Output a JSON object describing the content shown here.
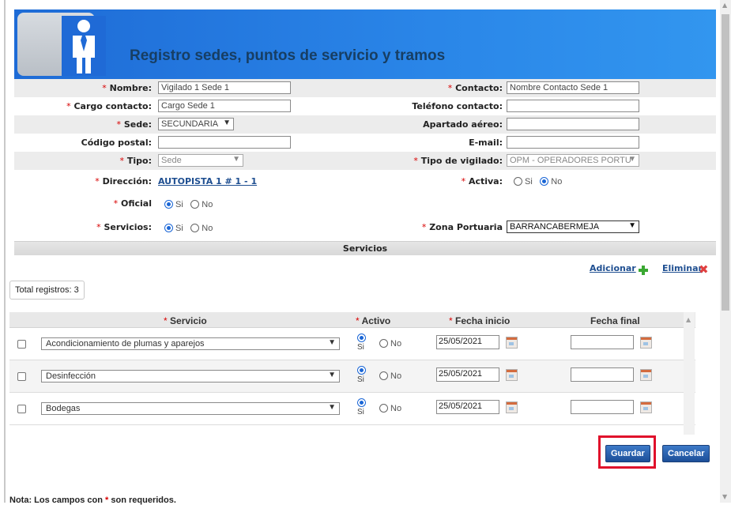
{
  "header": {
    "title": "Registro sedes, puntos de servicio y tramos"
  },
  "form": {
    "nombre": {
      "label": "Nombre:",
      "value": "Vigilado 1 Sede 1"
    },
    "contacto": {
      "label": "Contacto:",
      "value": "Nombre Contacto Sede 1"
    },
    "cargo_contacto": {
      "label": "Cargo contacto:",
      "value": "Cargo Sede 1"
    },
    "telefono_contacto": {
      "label": "Teléfono contacto:",
      "value": ""
    },
    "sede": {
      "label": "Sede:",
      "value": "SECUNDARIA"
    },
    "apartado_aereo": {
      "label": "Apartado aéreo:",
      "value": ""
    },
    "codigo_postal": {
      "label": "Código postal:",
      "value": ""
    },
    "email": {
      "label": "E-mail:",
      "value": ""
    },
    "tipo": {
      "label": "Tipo:",
      "value": "Sede"
    },
    "tipo_vigilado": {
      "label": "Tipo de vigilado:",
      "value": "OPM - OPERADORES PORTU"
    },
    "direccion": {
      "label": "Dirección:",
      "value": "AUTOPISTA 1 # 1 - 1"
    },
    "activa": {
      "label": "Activa:",
      "options": [
        "Si",
        "No"
      ],
      "selected": "No"
    },
    "oficial": {
      "label": "Oficial",
      "options": [
        "Si",
        "No"
      ],
      "selected": "Si"
    },
    "servicios": {
      "label": "Servicios:",
      "options": [
        "Si",
        "No"
      ],
      "selected": "Si"
    },
    "zona_portuaria": {
      "label": "Zona Portuaria",
      "value": "BARRANCABERMEJA"
    },
    "required_mark": "*"
  },
  "servicios_section": {
    "title": "Servicios",
    "add_label": "Adicionar",
    "delete_label": "Eliminar",
    "total_label": "Total registros: 3",
    "columns": {
      "servicio": "Servicio",
      "activo": "Activo",
      "fecha_inicio": "Fecha inicio",
      "fecha_final": "Fecha final"
    },
    "rows": [
      {
        "servicio": "Acondicionamiento de plumas y aparejos",
        "activo_si": "Si",
        "activo_no": "No",
        "activo": "Si",
        "fecha_inicio": "25/05/2021",
        "fecha_final": ""
      },
      {
        "servicio": "Desinfección",
        "activo_si": "Si",
        "activo_no": "No",
        "activo": "Si",
        "fecha_inicio": "25/05/2021",
        "fecha_final": ""
      },
      {
        "servicio": "Bodegas",
        "activo_si": "Si",
        "activo_no": "No",
        "activo": "Si",
        "fecha_inicio": "25/05/2021",
        "fecha_final": ""
      }
    ]
  },
  "buttons": {
    "guardar": "Guardar",
    "cancelar": "Cancelar"
  },
  "note": {
    "prefix": "Nota: Los campos con",
    "suffix": "son requeridos."
  },
  "colors": {
    "header_blue": "#2a86e8",
    "title_color": "#173e63",
    "required": "#d80000",
    "highlight": "#e0102b"
  }
}
